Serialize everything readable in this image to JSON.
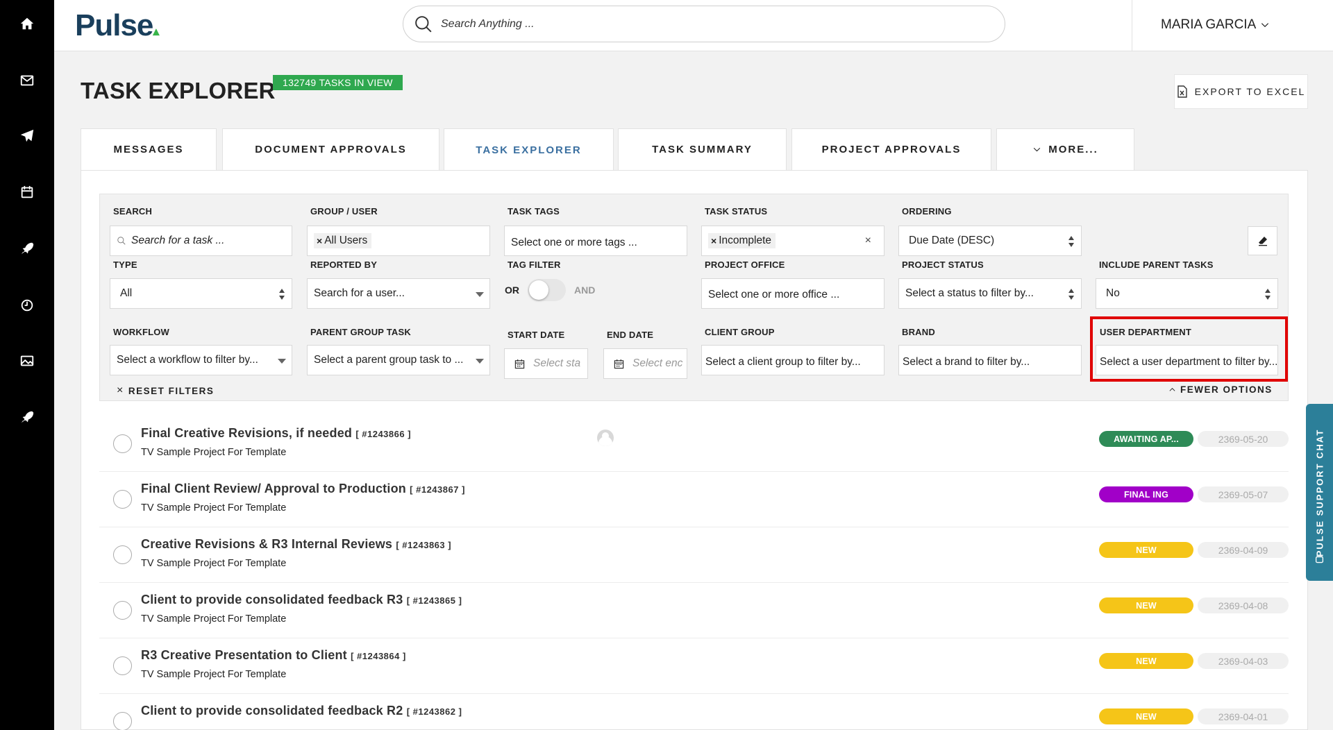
{
  "header": {
    "logo": "Pulse",
    "search_placeholder": "Search Anything ...",
    "user_name": "MARIA GARCIA"
  },
  "page": {
    "title": "TASK EXPLORER",
    "task_count_badge": "132749 TASKS IN VIEW",
    "export_label": "EXPORT TO EXCEL"
  },
  "tabs": [
    {
      "label": "MESSAGES",
      "active": false
    },
    {
      "label": "DOCUMENT APPROVALS",
      "active": false
    },
    {
      "label": "TASK EXPLORER",
      "active": true
    },
    {
      "label": "TASK SUMMARY",
      "active": false
    },
    {
      "label": "PROJECT APPROVALS",
      "active": false
    },
    {
      "label": "MORE...",
      "active": false
    }
  ],
  "filters": {
    "search": {
      "label": "SEARCH",
      "placeholder": "Search for a task ..."
    },
    "group_user": {
      "label": "GROUP / USER",
      "chip": "All Users"
    },
    "task_tags": {
      "label": "TASK TAGS",
      "placeholder": "Select one or more tags ..."
    },
    "task_status": {
      "label": "TASK STATUS",
      "chip": "Incomplete"
    },
    "ordering": {
      "label": "ORDERING",
      "value": "Due Date (DESC)"
    },
    "type": {
      "label": "TYPE",
      "value": "All"
    },
    "reported_by": {
      "label": "REPORTED BY",
      "placeholder": "Search for a user..."
    },
    "tag_filter": {
      "label": "TAG FILTER",
      "or": "OR",
      "and": "AND"
    },
    "project_office": {
      "label": "PROJECT OFFICE",
      "placeholder": "Select one or more office ..."
    },
    "project_status": {
      "label": "PROJECT STATUS",
      "placeholder": "Select a status to filter by..."
    },
    "include_parent_tasks": {
      "label": "INCLUDE PARENT TASKS",
      "value": "No"
    },
    "workflow": {
      "label": "WORKFLOW",
      "placeholder": "Select a workflow to filter by..."
    },
    "parent_group_task": {
      "label": "PARENT GROUP TASK",
      "placeholder": "Select a parent group task to ..."
    },
    "start_date": {
      "label": "START DATE",
      "placeholder": "Select sta"
    },
    "end_date": {
      "label": "END DATE",
      "placeholder": "Select enc"
    },
    "client_group": {
      "label": "CLIENT GROUP",
      "placeholder": "Select a client group to filter by..."
    },
    "brand": {
      "label": "BRAND",
      "placeholder": "Select a brand to filter by..."
    },
    "user_department": {
      "label": "USER DEPARTMENT",
      "placeholder": "Select a user department to filter by..."
    },
    "reset_label": "RESET FILTERS",
    "fewer_label": "FEWER OPTIONS"
  },
  "tasks": [
    {
      "title": "Final Creative Revisions, if needed",
      "id": "[ #1243866 ]",
      "project": "TV Sample Project For Template",
      "status": "AWAITING AP...",
      "status_color": "#2e8b57",
      "date": "2369-05-20",
      "has_avatar": true
    },
    {
      "title": "Final Client Review/ Approval to Production",
      "id": "[ #1243867 ]",
      "project": "TV Sample Project For Template",
      "status": "FINAL ING",
      "status_color": "#a100c8",
      "date": "2369-05-07",
      "has_avatar": false
    },
    {
      "title": "Creative Revisions & R3 Internal Reviews",
      "id": "[ #1243863 ]",
      "project": "TV Sample Project For Template",
      "status": "NEW",
      "status_color": "#f5c518",
      "date": "2369-04-09",
      "has_avatar": false
    },
    {
      "title": "Client to provide consolidated feedback R3",
      "id": "[ #1243865 ]",
      "project": "TV Sample Project For Template",
      "status": "NEW",
      "status_color": "#f5c518",
      "date": "2369-04-08",
      "has_avatar": false
    },
    {
      "title": "R3 Creative Presentation to Client",
      "id": "[ #1243864 ]",
      "project": "TV Sample Project For Template",
      "status": "NEW",
      "status_color": "#f5c518",
      "date": "2369-04-03",
      "has_avatar": false
    },
    {
      "title": "Client to provide consolidated feedback R2",
      "id": "[ #1243862 ]",
      "project": "",
      "status": "NEW",
      "status_color": "#f5c518",
      "date": "2369-04-01",
      "has_avatar": false
    }
  ],
  "support_chat": {
    "label": "PULSE SUPPORT CHAT"
  }
}
